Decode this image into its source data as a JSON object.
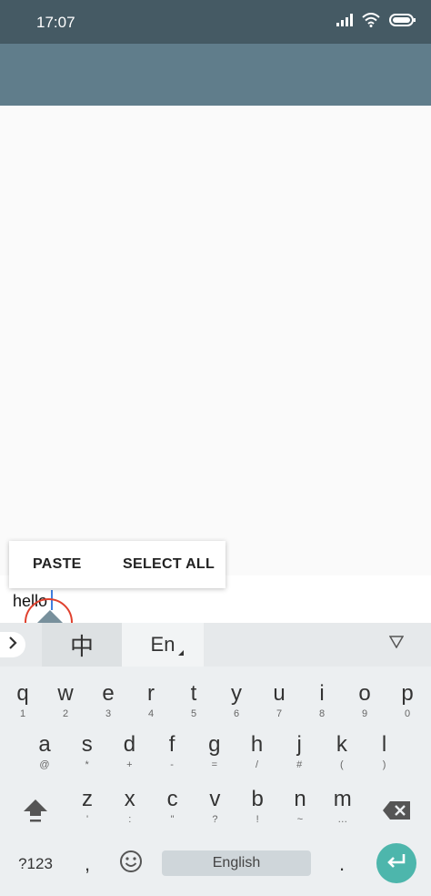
{
  "status_bar": {
    "time": "17:07",
    "icons": [
      "signal-icon",
      "wifi-icon",
      "battery-icon"
    ]
  },
  "context_menu": {
    "paste": "PASTE",
    "select_all": "SELECT ALL"
  },
  "input": {
    "value": "hello"
  },
  "keyboard": {
    "lang_zh": "中",
    "lang_en": "En",
    "row1": [
      {
        "main": "q",
        "sub": "1"
      },
      {
        "main": "w",
        "sub": "2"
      },
      {
        "main": "e",
        "sub": "3"
      },
      {
        "main": "r",
        "sub": "4"
      },
      {
        "main": "t",
        "sub": "5"
      },
      {
        "main": "y",
        "sub": "6"
      },
      {
        "main": "u",
        "sub": "7"
      },
      {
        "main": "i",
        "sub": "8"
      },
      {
        "main": "o",
        "sub": "9"
      },
      {
        "main": "p",
        "sub": "0"
      }
    ],
    "row2": [
      {
        "main": "a",
        "sub": "@"
      },
      {
        "main": "s",
        "sub": "*"
      },
      {
        "main": "d",
        "sub": "+"
      },
      {
        "main": "f",
        "sub": "-"
      },
      {
        "main": "g",
        "sub": "="
      },
      {
        "main": "h",
        "sub": "/"
      },
      {
        "main": "j",
        "sub": "#"
      },
      {
        "main": "k",
        "sub": "("
      },
      {
        "main": "l",
        "sub": ")"
      }
    ],
    "row3": [
      {
        "main": "z",
        "sub": "'"
      },
      {
        "main": "x",
        "sub": ":"
      },
      {
        "main": "c",
        "sub": "\""
      },
      {
        "main": "v",
        "sub": "?"
      },
      {
        "main": "b",
        "sub": "!"
      },
      {
        "main": "n",
        "sub": "~"
      },
      {
        "main": "m",
        "sub": "…"
      }
    ],
    "sym_key": "?123",
    "comma_key": ",",
    "space_label": "English",
    "period_key": ".",
    "enter_color": "#4db6ac"
  },
  "colors": {
    "status_bar": "#455a64",
    "app_bar": "#607d8b",
    "accent": "#4db6ac",
    "cursor": "#3f7fe0",
    "highlight_circle": "#e0412e"
  }
}
